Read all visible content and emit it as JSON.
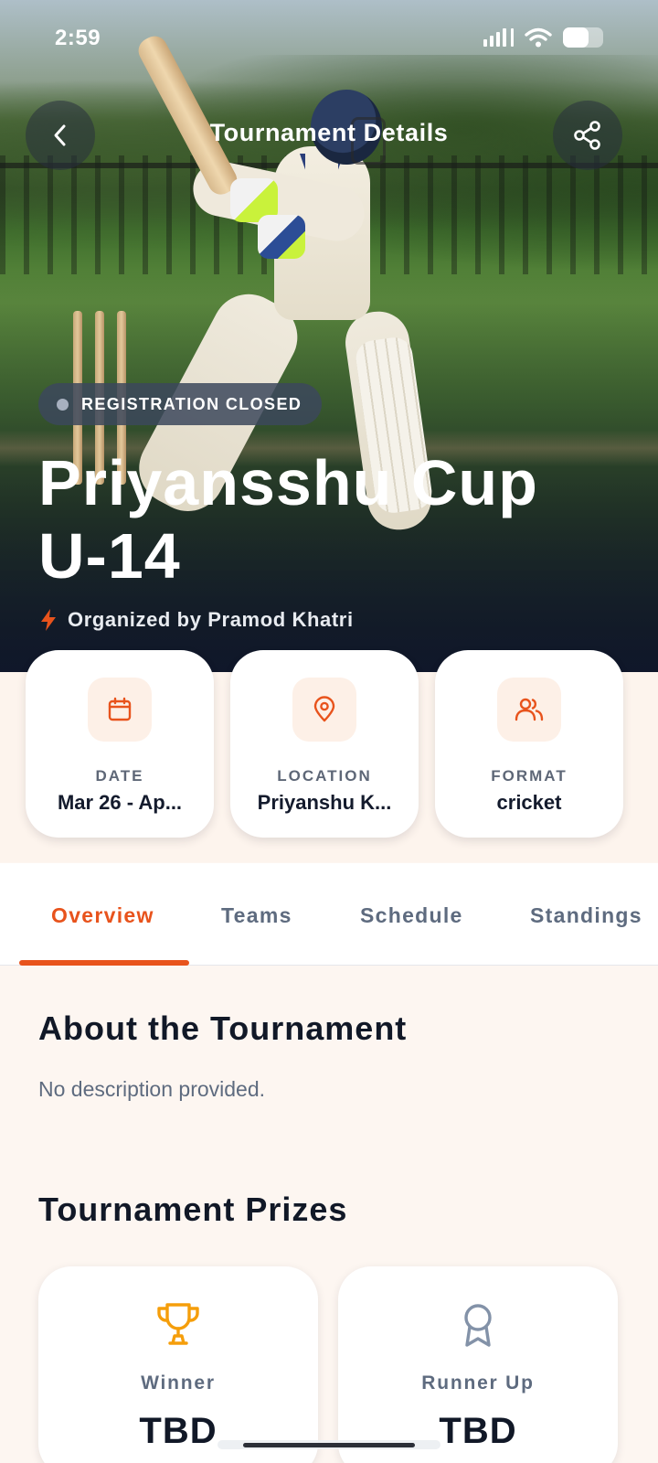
{
  "status_bar": {
    "time": "2:59"
  },
  "header": {
    "title": "Tournament Details"
  },
  "hero": {
    "badge": "REGISTRATION CLOSED",
    "title_line1": "Priyansshu Cup",
    "title_line2": "U-14",
    "organizer": "Organized by Pramod Khatri"
  },
  "info_cards": [
    {
      "label": "DATE",
      "value": "Mar 26 - Ap...",
      "icon": "calendar-icon"
    },
    {
      "label": "LOCATION",
      "value": "Priyanshu K...",
      "icon": "location-pin-icon"
    },
    {
      "label": "FORMAT",
      "value": "cricket",
      "icon": "users-icon"
    }
  ],
  "tabs": [
    {
      "label": "Overview",
      "active": true
    },
    {
      "label": "Teams",
      "active": false
    },
    {
      "label": "Schedule",
      "active": false
    },
    {
      "label": "Standings",
      "active": false
    }
  ],
  "about": {
    "title": "About the Tournament",
    "description": "No description provided."
  },
  "prizes": {
    "title": "Tournament Prizes",
    "items": [
      {
        "label": "Winner",
        "value": "TBD",
        "icon": "trophy-icon"
      },
      {
        "label": "Runner Up",
        "value": "TBD",
        "icon": "medal-icon"
      }
    ]
  },
  "colors": {
    "accent": "#e8531c",
    "text": "#141b2d",
    "muted": "#5e6b7f",
    "background": "#fdf6f1"
  }
}
